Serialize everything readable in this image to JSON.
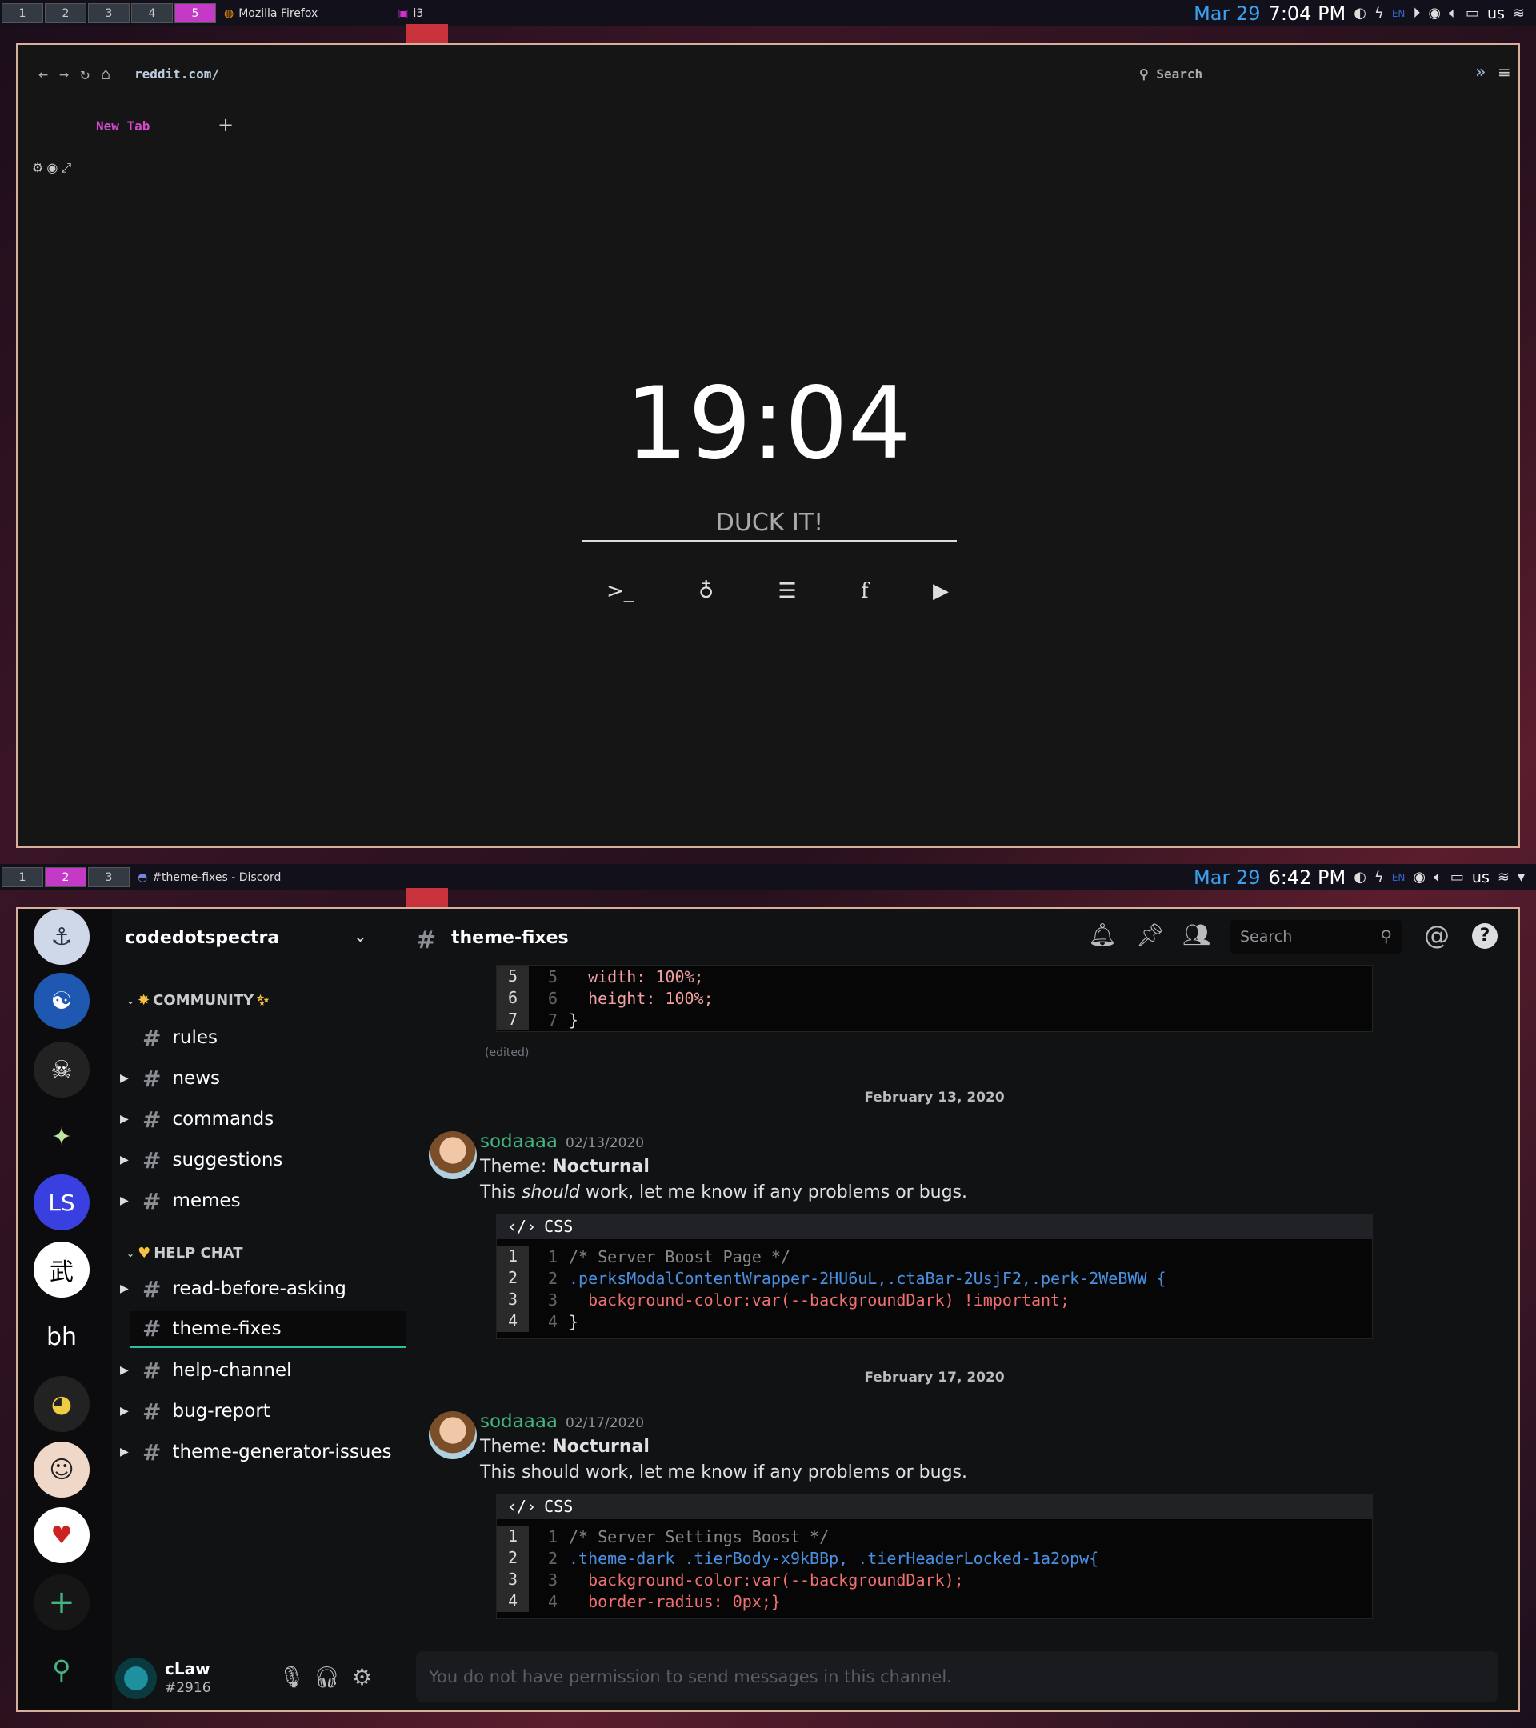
{
  "top_bar": {
    "workspaces": [
      "1",
      "2",
      "3",
      "4",
      "5"
    ],
    "active": "5",
    "windows": [
      "Mozilla Firefox",
      "i3"
    ],
    "date": "Mar 29",
    "time": "7:04 PM",
    "locale": "EN",
    "kbd": "us"
  },
  "firefox": {
    "url": "reddit.com/",
    "search": "Search",
    "tab": "New Tab",
    "new_tab_icon": "+",
    "clock": "19:04",
    "search_label": "DUCK IT!",
    "shortcuts": [
      "terminal-icon",
      "github-icon",
      "server-icon",
      "facebook-icon",
      "youtube-icon"
    ]
  },
  "bottom_bar": {
    "workspaces": [
      "1",
      "2",
      "3"
    ],
    "active": "2",
    "window": "#theme-fixes - Discord",
    "date": "Mar 29",
    "time": "6:42 PM",
    "locale": "EN",
    "kbd": "us"
  },
  "discord": {
    "server_name": "codedotspectra",
    "channel": "theme-fixes",
    "search_placeholder": "Search",
    "servers": [
      "bh"
    ],
    "categories": [
      {
        "name": "COMMUNITY",
        "channels": [
          "rules",
          "news",
          "commands",
          "suggestions",
          "memes"
        ]
      },
      {
        "name": "HELP CHAT",
        "channels": [
          "read-before-asking",
          "theme-fixes",
          "help-channel",
          "bug-report",
          "theme-generator-issues"
        ]
      }
    ],
    "user": {
      "name": "cLaw",
      "tag": "#2916"
    },
    "top_code": [
      {
        "n": "5",
        "code": "  width: 100%;"
      },
      {
        "n": "6",
        "code": "  height: 100%;"
      },
      {
        "n": "7",
        "code": "}"
      }
    ],
    "edited": "(edited)",
    "messages": [
      {
        "date": "February 13, 2020",
        "author": "sodaaaa",
        "timestamp": "02/13/2020",
        "theme_prefix": "Theme: ",
        "theme": "Nocturnal",
        "text_a": "This ",
        "text_em": "should",
        "text_b": " work, let me know if any problems or bugs.",
        "lang": "CSS",
        "code": [
          {
            "n": "1",
            "code": "/* Server Boost Page */"
          },
          {
            "n": "2",
            "code": ".perksModalContentWrapper-2HU6uL,.ctaBar-2UsjF2,.perk-2WeBWW {"
          },
          {
            "n": "3",
            "code": "  background-color:var(--backgroundDark) !important;"
          },
          {
            "n": "4",
            "code": "}"
          }
        ]
      },
      {
        "date": "February 17, 2020",
        "author": "sodaaaa",
        "timestamp": "02/17/2020",
        "theme_prefix": "Theme: ",
        "theme": "Nocturnal",
        "text": "This should work, let me know if any problems or bugs.",
        "lang": "CSS",
        "code": [
          {
            "n": "1",
            "code": "/* Server Settings Boost */"
          },
          {
            "n": "2",
            "code": ".theme-dark .tierBody-x9kBBp, .tierHeaderLocked-1a2opw{"
          },
          {
            "n": "3",
            "code": "  background-color:var(--backgroundDark);"
          },
          {
            "n": "4",
            "code": "  border-radius: 0px;}"
          }
        ]
      }
    ],
    "input_placeholder": "You do not have permission to send messages in this channel."
  }
}
